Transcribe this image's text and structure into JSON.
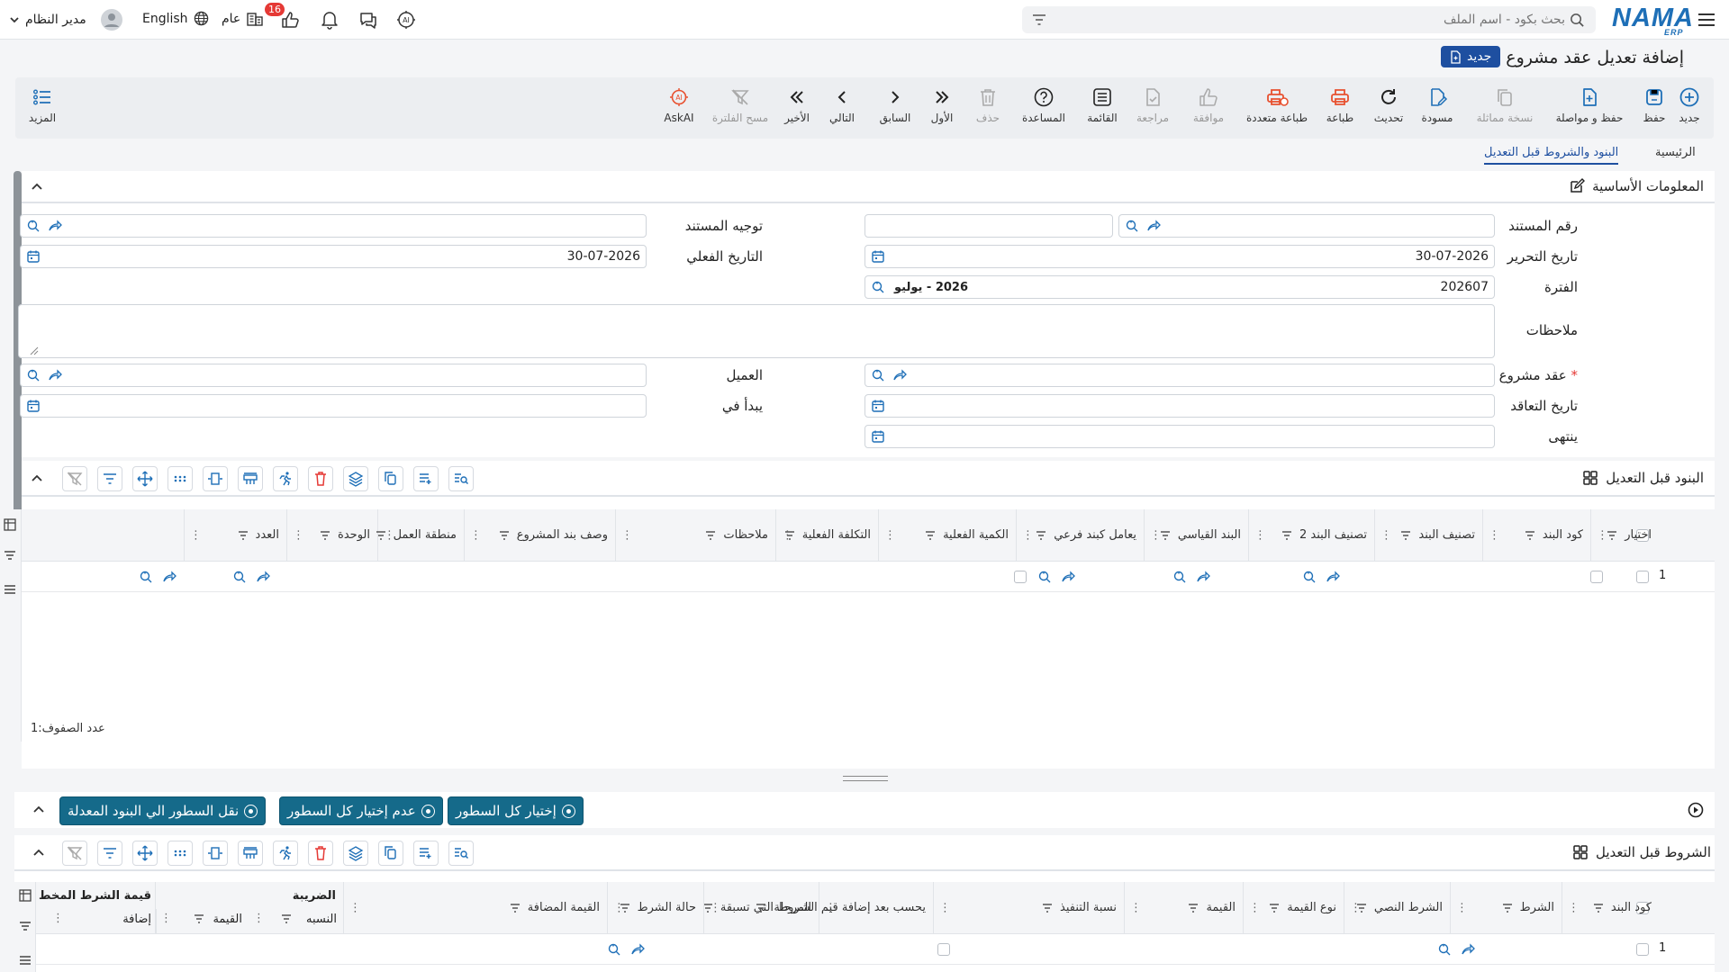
{
  "header": {
    "user_name": "مدير النظام",
    "language": "English",
    "scope": "عام",
    "notification_count": "16",
    "search_placeholder": "بحث بكود - اسم الملف",
    "logo_text": "NAMA",
    "logo_sub": "ERP"
  },
  "page": {
    "title": "إضافة تعديل عقد مشروع",
    "status_badge": "جديد"
  },
  "toolbar": {
    "new": "جديد",
    "save": "حفظ",
    "save_continue": "حفظ و مواصلة",
    "duplicate": "نسخة مماثلة",
    "draft": "مسودة",
    "refresh": "تحديث",
    "print": "طباعة",
    "multi_print": "طباعة متعددة",
    "approve": "موافقة",
    "review": "مراجعة",
    "list": "القائمة",
    "help": "المساعدة",
    "delete": "حذف",
    "first": "الأول",
    "previous": "السابق",
    "next": "التالي",
    "last": "الأخير",
    "clear_filter": "مسح الفلترة",
    "ask_ai": "AskAI",
    "more": "المزيد"
  },
  "tabs": {
    "main": "الرئيسية",
    "terms": "البنود والشروط قبل التعديل"
  },
  "basic_info": {
    "section_title": "المعلومات الأساسية",
    "doc_number_label": "رقم المستند",
    "doc_number_value": "",
    "doc_direction_label": "توجيه المستند",
    "edit_date_label": "تاريخ التحرير",
    "edit_date_value": "30-07-2026",
    "actual_date_label": "التاريخ الفعلي",
    "actual_date_value": "30-07-2026",
    "period_label": "الفترة",
    "period_value": "202607",
    "period_name": "2026 - يوليو",
    "notes_label": "ملاحظات",
    "project_contract_label": "عقد مشروع",
    "customer_label": "العميل",
    "contract_date_label": "تاريخ التعاقد",
    "starts_at_label": "يبدأ في",
    "ends_label": "ينتهى"
  },
  "items_grid": {
    "section_title": "البنود قبل التعديل",
    "columns": [
      "اختيار",
      "كود البند",
      "تصنيف البند",
      "تصنيف البند 2",
      "البند القياسي",
      "يعامل كبند فرعي",
      "الكمية الفعلية",
      "التكلفة الفعلية",
      "ملاحظات",
      "وصف بند المشروع",
      "منطقة العمل",
      "الوحدة",
      "العدد"
    ],
    "rows": [
      {
        "index": "1"
      }
    ],
    "row_count_label": "عدد الصفوف:",
    "row_count": "1"
  },
  "actions": {
    "select_all": "إختيار كل السطور",
    "deselect_all": "عدم إختيار كل السطور",
    "move_lines": "نقل السطور الي البنود المعدلة"
  },
  "conditions_grid": {
    "section_title": "الشروط قبل التعديل",
    "columns": [
      "كود البند",
      "الشرط",
      "الشرط النصي",
      "نوع القيمة",
      "القيمة",
      "نسبة التنفيذ",
      "يحسب بعد إضافة قيم الشروط التي تسبقة",
      "المرحلة",
      "حالة الشرط",
      "القيمة المضافة"
    ],
    "tax_group": "الضريبة",
    "tax_sub": [
      "النسبه",
      "القيمة"
    ],
    "plan_group": "قيمة الشرط المخط",
    "plan_sub": [
      "إضافة"
    ],
    "rows": [
      {
        "index": "1"
      }
    ]
  },
  "colors": {
    "brand": "#1e6fb7",
    "badge_bg": "#1e4fa0",
    "action_btn": "#156a8a",
    "print_icon": "#e8502f",
    "delete_icon": "#e53935"
  }
}
